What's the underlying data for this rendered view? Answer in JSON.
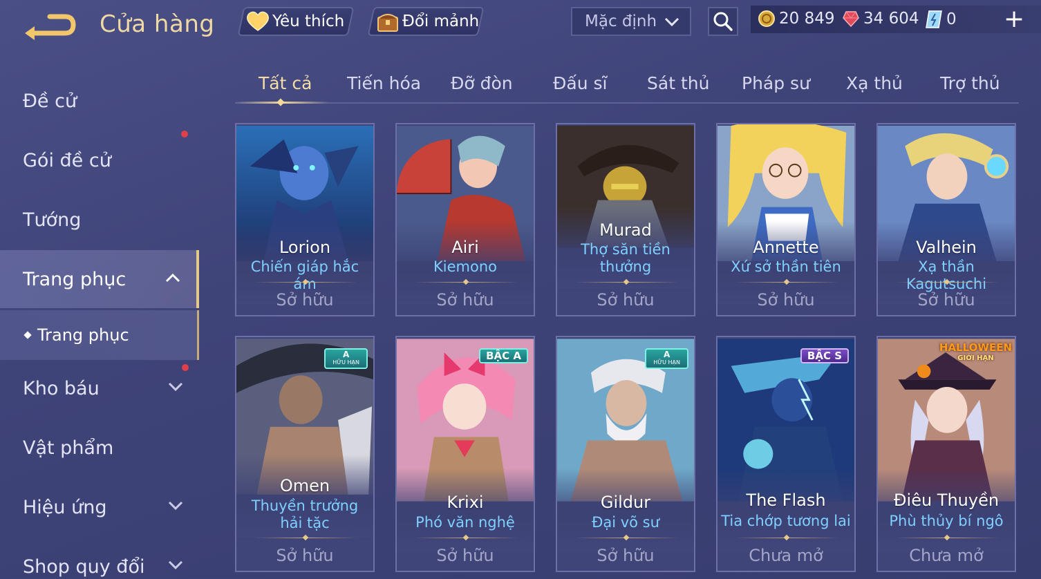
{
  "header": {
    "title": "Cửa hàng",
    "favorites_label": "Yêu thích",
    "shard_exchange_label": "Đổi mảnh",
    "sort_value": "Mặc định"
  },
  "currency": {
    "gold": "20 849",
    "ruby": "34 604",
    "voucher": "0"
  },
  "sidebar": {
    "items": [
      {
        "label": "Đề cử"
      },
      {
        "label": "Gói đề cử"
      },
      {
        "label": "Tướng"
      },
      {
        "label": "Trang phục"
      },
      {
        "label": "Kho báu"
      },
      {
        "label": "Vật phẩm"
      },
      {
        "label": "Hiệu ứng"
      },
      {
        "label": "Shop quy đổi"
      }
    ],
    "subitem": "Trang phục"
  },
  "tabs": [
    "Tất cả",
    "Tiến hóa",
    "Đỡ đòn",
    "Đấu sĩ",
    "Sát thủ",
    "Pháp sư",
    "Xạ thủ",
    "Trợ thủ"
  ],
  "cards": [
    {
      "hero": "Lorion",
      "skin": "Chiến giáp hắc ám",
      "status": "Sở hữu"
    },
    {
      "hero": "Airi",
      "skin": "Kiemono",
      "status": "Sở hữu"
    },
    {
      "hero": "Murad",
      "skin": "Thợ săn tiền thưởng",
      "status": "Sở hữu"
    },
    {
      "hero": "Annette",
      "skin": "Xứ sở thần tiên",
      "status": "Sở hữu"
    },
    {
      "hero": "Valhein",
      "skin": "Xạ thần Kagutsuchi",
      "status": "Sở hữu"
    },
    {
      "hero": "Omen",
      "skin": "Thuyền trưởng hải tặc",
      "status": "Sở hữu",
      "badge": "A",
      "badge_sub": "HỮU HẠN"
    },
    {
      "hero": "Krixi",
      "skin": "Phó văn nghệ",
      "status": "Sở hữu",
      "badge": "BẬC A"
    },
    {
      "hero": "Gildur",
      "skin": "Đại võ sư",
      "status": "Sở hữu",
      "badge": "A",
      "badge_sub": "HỮU HẠN"
    },
    {
      "hero": "The Flash",
      "skin": "Tia chớp tương lai",
      "status": "Chưa mở",
      "badge": "BẬC S"
    },
    {
      "hero": "Điêu Thuyền",
      "skin": "Phù thủy bí ngô",
      "status": "Chưa mở",
      "badge": "HALLOWEEN",
      "badge_sub": "GIỚI HẠN"
    }
  ],
  "colors": {
    "accent_gold": "#f3dca6",
    "skin_blue": "#7fd0ff",
    "status_gray": "#a3a6c8",
    "notification_red": "#e0404a"
  }
}
